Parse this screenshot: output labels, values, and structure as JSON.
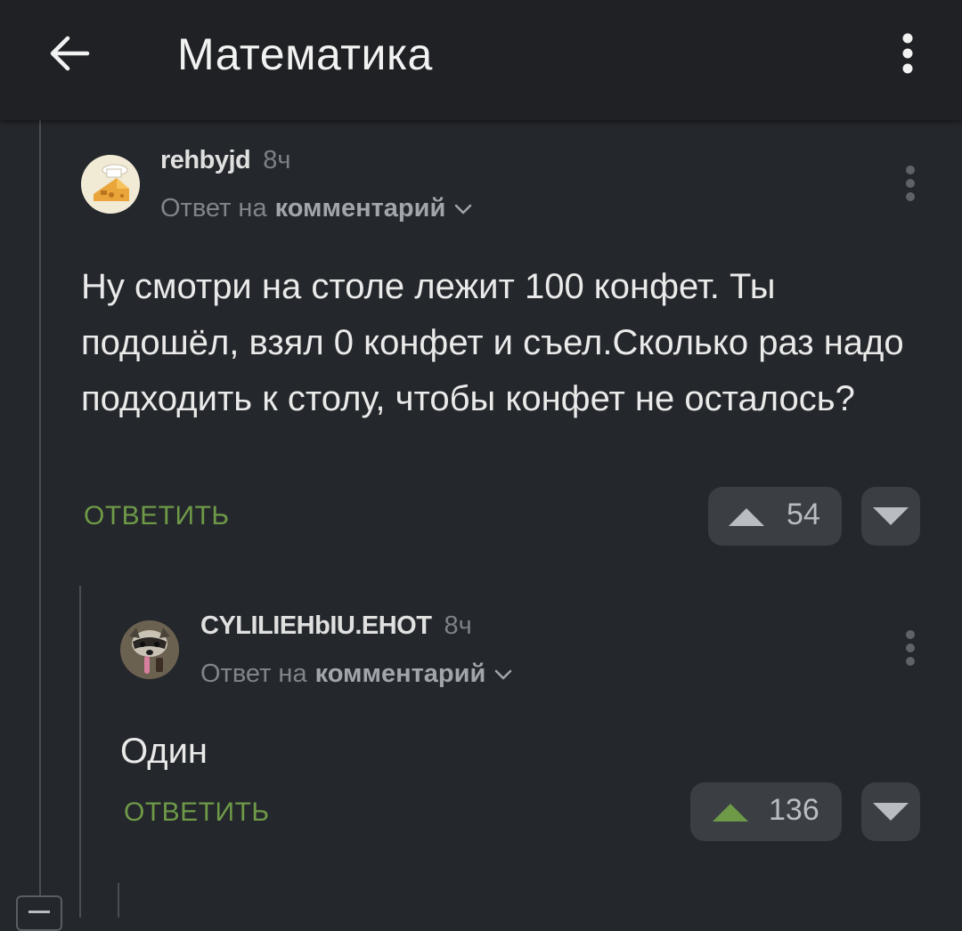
{
  "app_bar": {
    "title": "Математика",
    "back_icon": "arrow-left-icon",
    "menu_icon": "more-vert-icon"
  },
  "comments": [
    {
      "author": "rehbyjd",
      "time": "8ч",
      "reply_prefix": "Ответ на",
      "reply_target": "комментарий",
      "text": "Ну смотри на столе лежит 100 конфет. Ты подошёл, взял 0 конфет и съел.Сколько раз надо подходить к столу, чтобы конфет не осталось?",
      "reply_label": "ОТВЕТИТЬ",
      "score": "54",
      "upvoted": false
    },
    {
      "author": "CYLILIEHbIU.EHOT",
      "time": "8ч",
      "reply_prefix": "Ответ на",
      "reply_target": "комментарий",
      "text": "Один",
      "reply_label": "ОТВЕТИТЬ",
      "score": "136",
      "upvoted": true
    }
  ],
  "colors": {
    "background": "#24272b",
    "app_bar": "#1f2124",
    "accent_green": "#6e9a48",
    "vote_pill": "#3b3f44"
  }
}
